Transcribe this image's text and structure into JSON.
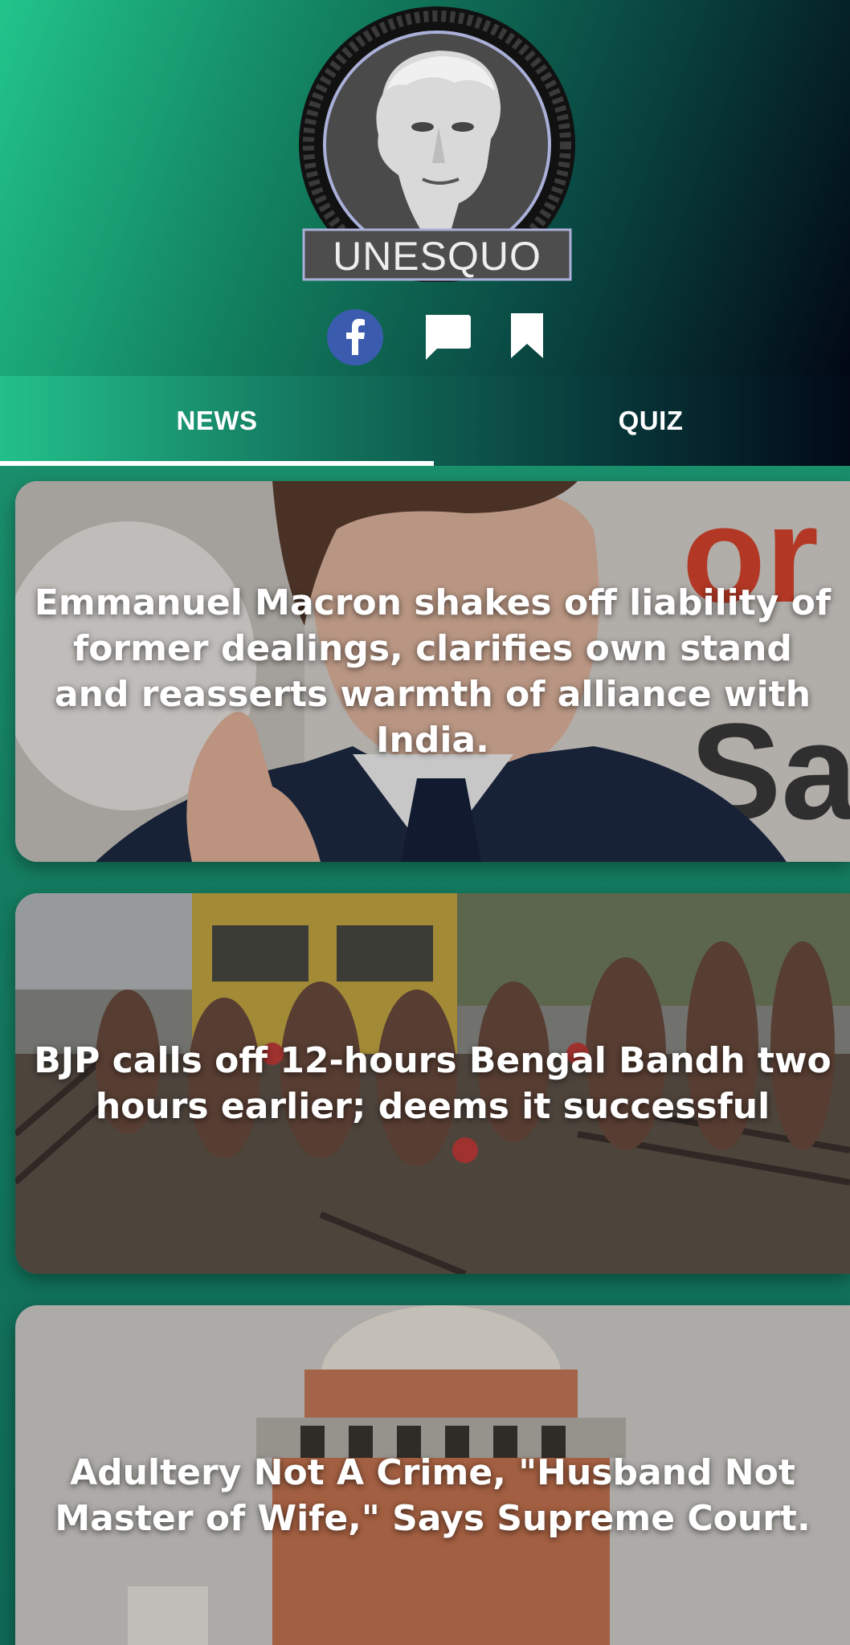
{
  "app": {
    "logo_text": "UNESQUO"
  },
  "social": {
    "facebook_icon": "facebook-icon",
    "chat_icon": "chat-icon",
    "bookmark_icon": "bookmark-icon"
  },
  "tabs": [
    {
      "label": "NEWS",
      "active": true
    },
    {
      "label": "QUIZ",
      "active": false
    }
  ],
  "articles": [
    {
      "headline": "Emmanuel Macron shakes off liability of former dealings, clarifies own stand and reasserts warmth of alliance with India."
    },
    {
      "headline": "BJP calls off 12-hours Bengal Bandh two hours earlier; deems it successful"
    },
    {
      "headline": "Adultery Not A Crime, \"Husband Not Master of Wife,\" Says Supreme Court."
    }
  ],
  "colors": {
    "accent": "#1fc48a",
    "dark": "#020814",
    "facebook": "#3b5cae"
  }
}
